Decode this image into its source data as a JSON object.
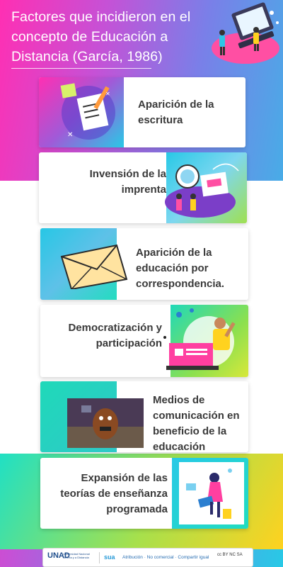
{
  "header": {
    "title": "Factores que incidieron en el concepto de Educación a Distancia (García, 1986)"
  },
  "items": [
    {
      "text": "Aparición de la escritura"
    },
    {
      "text": "Invensión de la imprenta"
    },
    {
      "text": "Aparición de la educación por correspondencia."
    },
    {
      "text": "Democratización y participación"
    },
    {
      "text": "Medios de comunicación en beneficio de la educación"
    },
    {
      "text": "Expansión de las teorías de enseñanza programada"
    }
  ],
  "footer": {
    "logo": "UNAD",
    "logo_subtitle": "Universidad Nacional Abierta y a Distancia",
    "brand": "sua",
    "license": "Atribución · No comercial · Compartir igual",
    "cc_marks": "cc BY NC SA"
  },
  "colors": {
    "magenta": "#ff2fb3",
    "cyan": "#28c9e6",
    "green": "#1fd9b9",
    "yellow": "#ffd21f",
    "text_dark": "#3a3a3a"
  }
}
